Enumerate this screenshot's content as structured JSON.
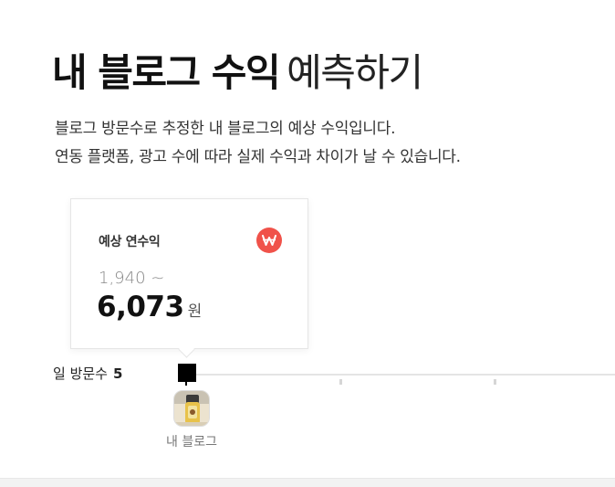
{
  "header": {
    "title_bold": "내 블로그 수익",
    "title_light": "예측하기",
    "description_line1": "블로그 방문수로 추정한 내 블로그의 예상 수익입니다.",
    "description_line2": "연동 플랫폼, 광고 수에 따라 실제 수익과 차이가 날 수 있습니다."
  },
  "estimate_card": {
    "label": "예상 연수익",
    "icon": "won-icon",
    "range_min": "1,940 ~",
    "amount": "6,073",
    "unit": "원"
  },
  "visits": {
    "label": "일 방문수",
    "value": "5",
    "slider_position": 0
  },
  "blog": {
    "avatar_label": "내 블로그"
  },
  "colors": {
    "accent_red": "#f0524a",
    "handle": "#000000",
    "track": "#e4e4e4"
  }
}
